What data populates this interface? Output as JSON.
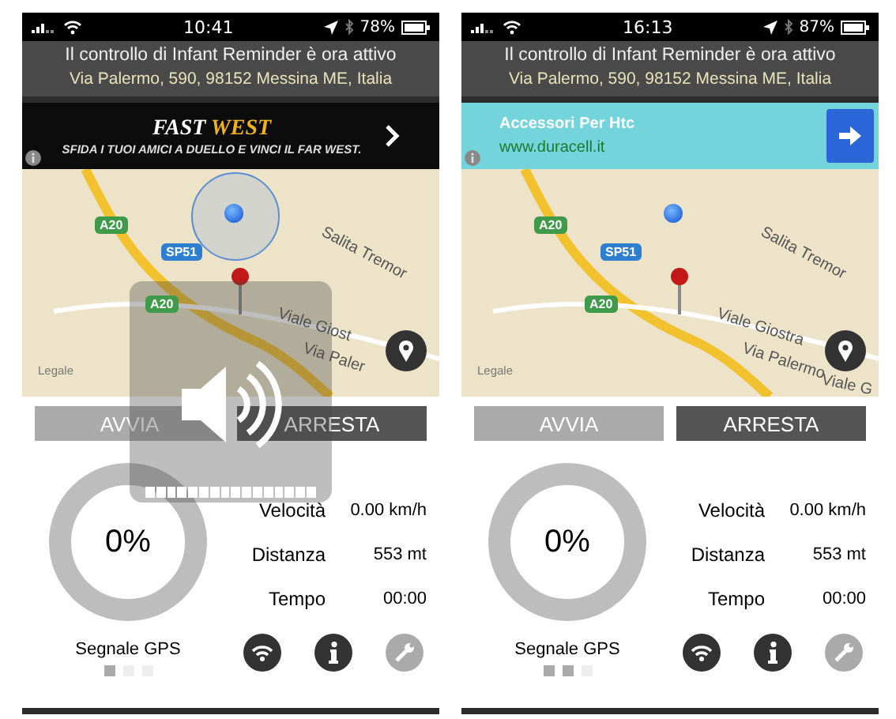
{
  "phones": [
    {
      "status": {
        "time": "10:41",
        "battery": "78%"
      },
      "notice": {
        "title": "Il controllo di Infant Reminder è ora attivo",
        "address": "Via Palermo, 590, 98152 Messina ME, Italia"
      },
      "ad": {
        "kind": "banner",
        "headline": [
          "FAST",
          "WEST"
        ],
        "tagline": "SFIDA I TUOI AMICI A DUELLO E VINCI IL FAR WEST."
      },
      "map": {
        "accuracy_circle": true,
        "shields": [
          {
            "text": "A20",
            "color": "#3f9a4a"
          },
          {
            "text": "SP51",
            "color": "#2f7fd0"
          },
          {
            "text": "A20",
            "color": "#3f9a4a"
          }
        ],
        "streets": [
          "Salita Tremor",
          "Viale Giost",
          "Via Paler"
        ],
        "legal": "Legale"
      },
      "buttons": [
        "AVVIA",
        "ARRESTA"
      ],
      "gauge": {
        "reading": "0%"
      },
      "stats": [
        {
          "label": "Velocità",
          "value": "0.00 km/h"
        },
        {
          "label": "Distanza",
          "value": "553 mt"
        },
        {
          "label": "Tempo",
          "value": "00:00"
        }
      ],
      "gps": {
        "label": "Segnale GPS",
        "bars": [
          {
            "on": true
          },
          {
            "on": false
          },
          {
            "on": false
          }
        ]
      },
      "volume_overlay": {
        "level": 1
      }
    },
    {
      "status": {
        "time": "16:13",
        "battery": "87%"
      },
      "notice": {
        "title": "Il controllo di Infant Reminder è ora attivo",
        "address": "Via Palermo, 590, 98152 Messina ME, Italia"
      },
      "ad": {
        "kind": "text",
        "title": "Accessori Per Htc",
        "url": "www.duracell.it"
      },
      "map": {
        "accuracy_circle": false,
        "shields": [
          {
            "text": "A20",
            "color": "#3f9a4a"
          },
          {
            "text": "SP51",
            "color": "#2f7fd0"
          },
          {
            "text": "A20",
            "color": "#3f9a4a"
          }
        ],
        "streets": [
          "Salita Tremor",
          "Viale Giostra",
          "Via Palermo",
          "Viale G"
        ],
        "legal": "Legale"
      },
      "buttons": [
        "AVVIA",
        "ARRESTA"
      ],
      "gauge": {
        "reading": "0%"
      },
      "stats": [
        {
          "label": "Velocità",
          "value": "0.00 km/h"
        },
        {
          "label": "Distanza",
          "value": "553 mt"
        },
        {
          "label": "Tempo",
          "value": "00:00"
        }
      ],
      "gps": {
        "label": "Segnale GPS",
        "bars": [
          {
            "on": true
          },
          {
            "on": true
          },
          {
            "on": false
          }
        ]
      }
    }
  ]
}
